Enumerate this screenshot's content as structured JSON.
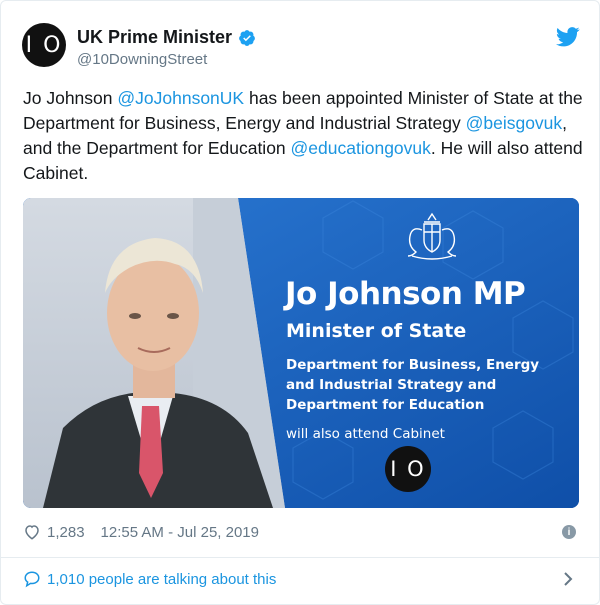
{
  "account": {
    "avatar_text": "I O",
    "name": "UK Prime Minister",
    "handle": "@10DowningStreet"
  },
  "tweet": {
    "parts": [
      {
        "text": "Jo Johnson ",
        "link": false
      },
      {
        "text": "@JoJohnsonUK",
        "link": true
      },
      {
        "text": " has been appointed Minister of State at the Department for Business, Energy and Industrial Strategy ",
        "link": false
      },
      {
        "text": "@beisgovuk",
        "link": true
      },
      {
        "text": ", and the Department for Education ",
        "link": false
      },
      {
        "text": "@educationgovuk",
        "link": true
      },
      {
        "text": ". He will also attend Cabinet.",
        "link": false
      }
    ]
  },
  "media": {
    "heading": "Jo Johnson MP",
    "role": "Minister of State",
    "department": "Department for Business, Energy and Industrial Strategy and Department for Education",
    "cabinet": "will also attend Cabinet",
    "logo_text": "I O"
  },
  "stats": {
    "likes": "1,283",
    "timestamp": "12:55 AM - Jul 25, 2019"
  },
  "footer": {
    "talking": "1,010 people are talking about this"
  },
  "colors": {
    "link": "#1b95e0",
    "brand_blue": "#1da1f2",
    "panel_blue": "#1a5fb4"
  },
  "icons": [
    "verified-icon",
    "twitter-bird-icon",
    "heart-icon",
    "info-icon",
    "comment-icon",
    "chevron-right-icon",
    "royal-crest-icon"
  ]
}
